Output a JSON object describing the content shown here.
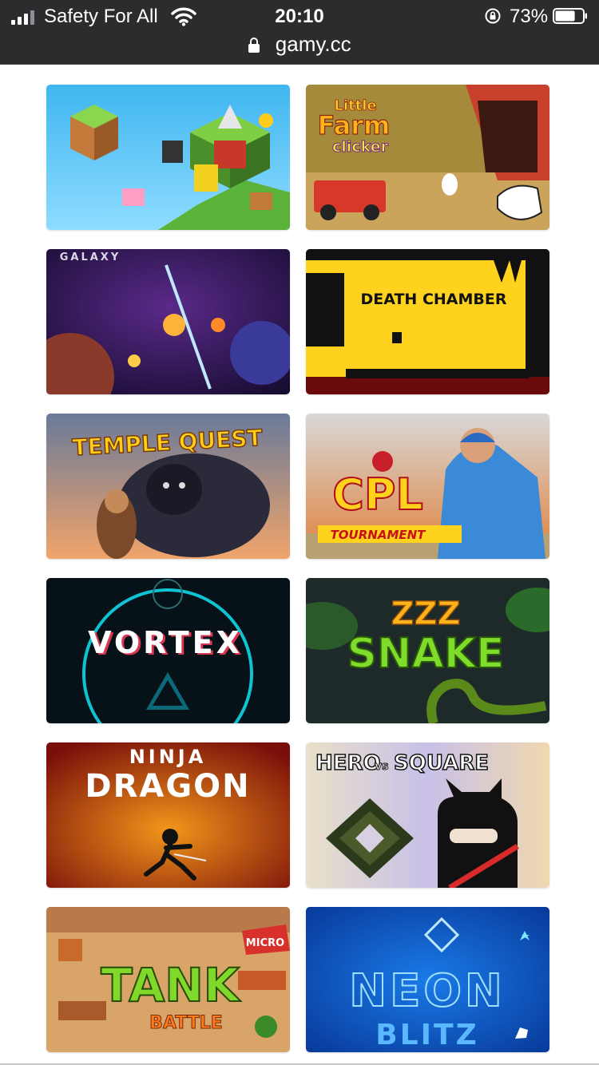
{
  "status_bar": {
    "carrier": "Safety For All",
    "time": "20:10",
    "battery_percent": "73%",
    "battery_level": 0.73,
    "url": "gamy.cc"
  },
  "games": [
    {
      "title": "",
      "art": "voxel-block-world"
    },
    {
      "title": "Little Farm clicker",
      "line1": "Little",
      "line2": "Farm",
      "line3": "clicker"
    },
    {
      "title": "GALAXY",
      "line1": "GALAXY"
    },
    {
      "title": "DEATH CHAMBER",
      "line1": "DEATH CHAMBER"
    },
    {
      "title": "TEMPLE QUEST",
      "line1": "TEMPLE QUEST"
    },
    {
      "title": "CPL TOURNAMENT",
      "line1": "CPL",
      "line2": "TOURNAMENT"
    },
    {
      "title": "VORTEX",
      "line1": "VORTEX"
    },
    {
      "title": "ZZZ SNAKE",
      "line1": "ZZZ",
      "line2": "SNAKE"
    },
    {
      "title": "NINJA DRAGON",
      "line1": "NINJA",
      "line2": "DRAGON"
    },
    {
      "title": "HERO vs SQUARE",
      "line1": "HERO",
      "line2": "vs",
      "line3": "SQUARE"
    },
    {
      "title": "MICRO TANK BATTLE",
      "line1": "MICRO",
      "line2": "TANK",
      "line3": "BATTLE"
    },
    {
      "title": "NEON BLITZ",
      "line1": "NEON",
      "line2": "BLITZ"
    }
  ]
}
